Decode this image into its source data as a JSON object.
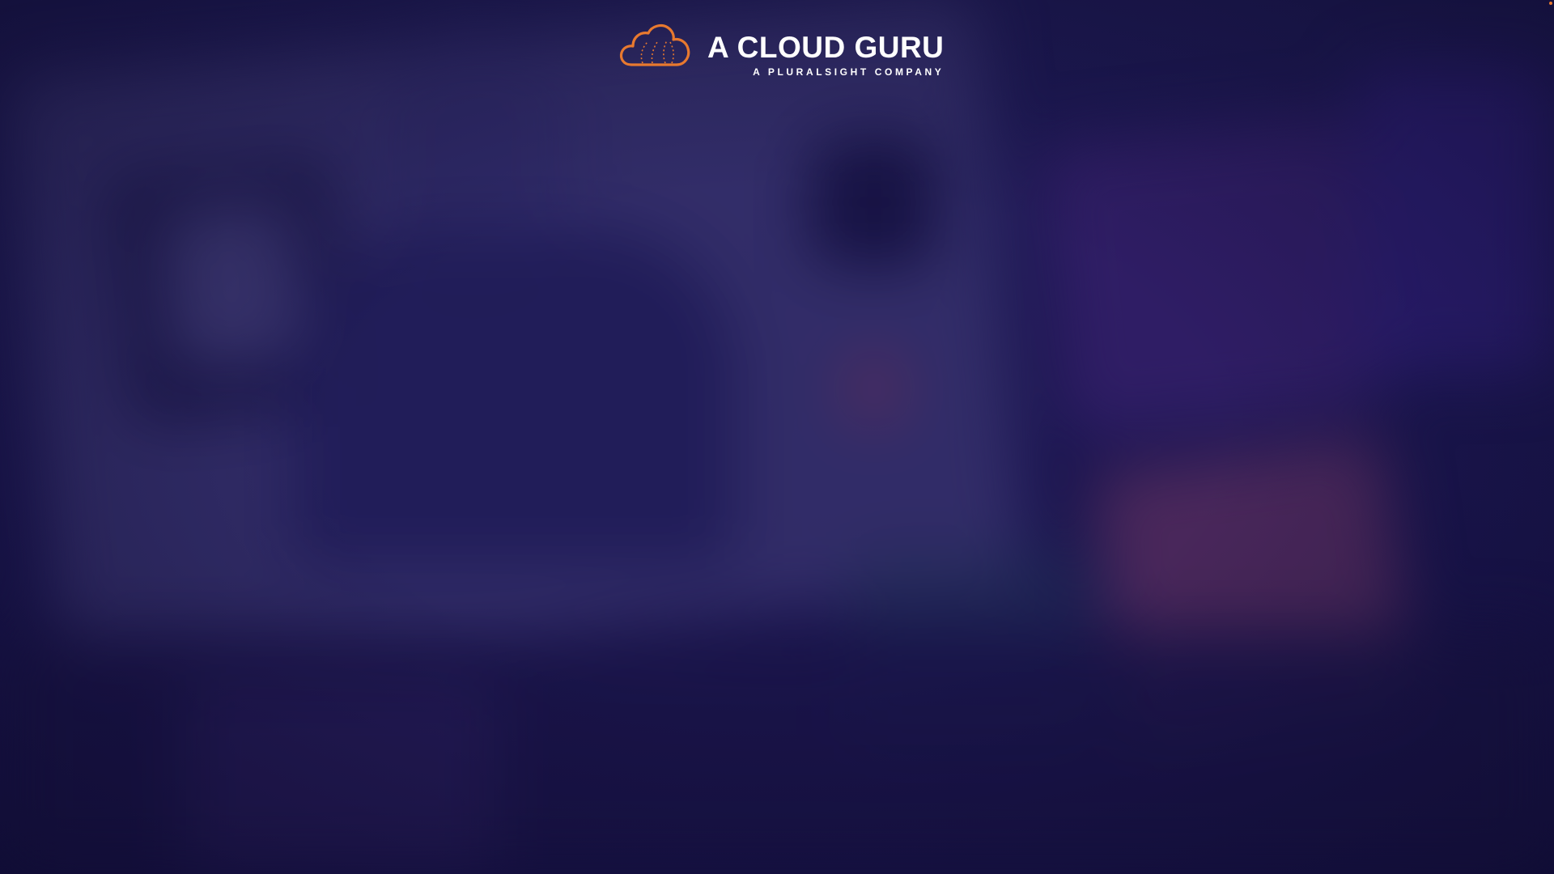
{
  "logo": {
    "title": "A CLOUD GURU",
    "subtitle": "A PLURALSIGHT COMPANY",
    "icon": "cloud-icon",
    "accent_color": "#e8792f",
    "text_color": "#ffffff"
  },
  "background": {
    "base_color": "#1c1752"
  }
}
